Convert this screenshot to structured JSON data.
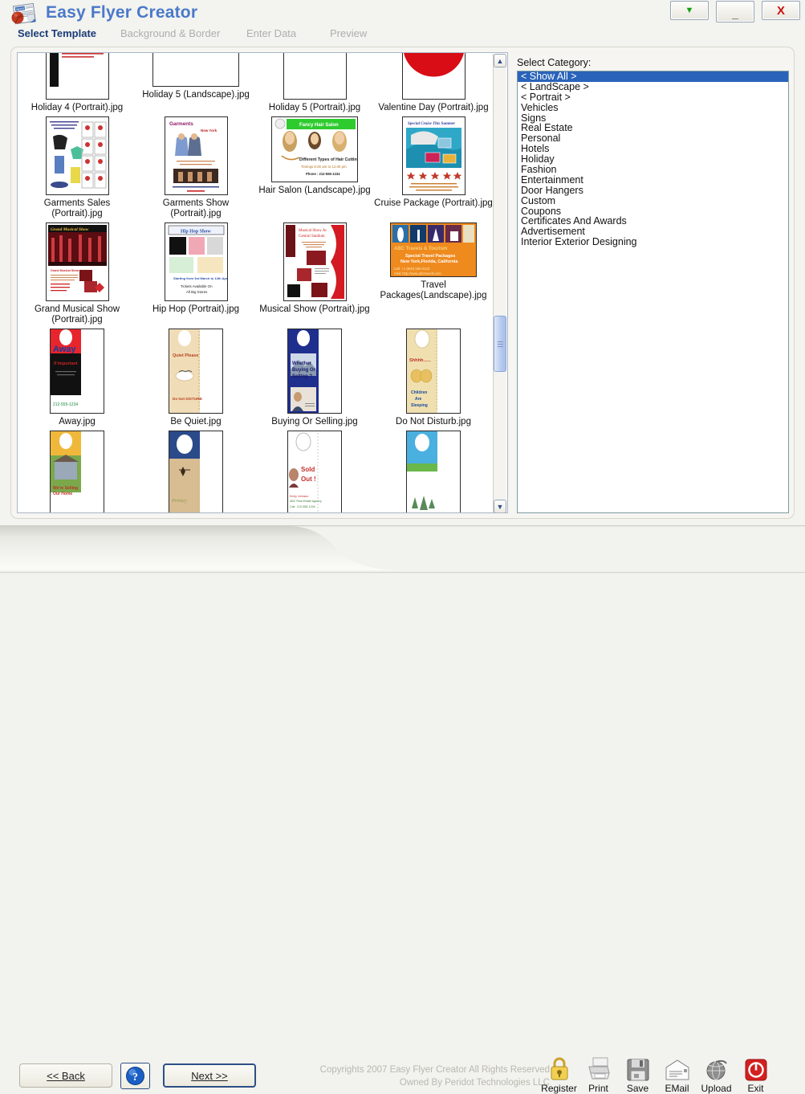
{
  "window": {
    "app_title": "Easy Flyer Creator",
    "logo_icon": "flyer-document-icon",
    "buttons": {
      "dropdown_label": "▼",
      "dropdown_icon": "chevron-down-icon",
      "minimize_label": "_",
      "minimize_icon": "minimize-icon",
      "close_label": "X",
      "close_icon": "close-icon"
    },
    "accent_blue": "#4a79c9",
    "close_red": "#cc1111",
    "dropdown_green": "#10a010"
  },
  "steps": [
    {
      "label": "Select Template",
      "active": true
    },
    {
      "label": "Background & Border",
      "active": false
    },
    {
      "label": "Enter Data",
      "active": false
    },
    {
      "label": "Preview",
      "active": false
    }
  ],
  "templates": {
    "rows": [
      [
        {
          "caption": "Holiday 4 (Portrait).jpg",
          "shape": "port"
        },
        {
          "caption": "Holiday 5 (Landscape).jpg",
          "shape": "land"
        },
        {
          "caption": "Holiday 5 (Portrait).jpg",
          "shape": "port"
        },
        {
          "caption": "Valentine Day (Portrait).jpg",
          "shape": "port"
        }
      ],
      [
        {
          "caption": "Garments Sales (Portrait).jpg",
          "shape": "port"
        },
        {
          "caption": "Garments Show (Portrait).jpg",
          "shape": "port"
        },
        {
          "caption": "Hair Salon (Landscape).jpg",
          "shape": "land"
        },
        {
          "caption": "Cruise Package (Portrait).jpg",
          "shape": "port"
        }
      ],
      [
        {
          "caption": "Grand Musical Show\n(Portrait).jpg",
          "shape": "port"
        },
        {
          "caption": "Hip Hop (Portrait).jpg",
          "shape": "port"
        },
        {
          "caption": "Musical Show (Portrait).jpg",
          "shape": "port"
        },
        {
          "caption": "Travel\nPackages(Landscape).jpg",
          "shape": "wide"
        }
      ],
      [
        {
          "caption": "Away.jpg",
          "shape": "hang"
        },
        {
          "caption": "Be Quiet.jpg",
          "shape": "hang"
        },
        {
          "caption": "Buying Or Selling.jpg",
          "shape": "hang"
        },
        {
          "caption": "Do Not Disturb.jpg",
          "shape": "hang"
        }
      ],
      [
        {
          "caption": "",
          "shape": "hang"
        },
        {
          "caption": "",
          "shape": "hang"
        },
        {
          "caption": "",
          "shape": "hang"
        },
        {
          "caption": "",
          "shape": "hang"
        }
      ]
    ],
    "scrollbar": {
      "up_icon": "scroll-up-icon",
      "down_icon": "scroll-down-icon",
      "up_label": "▲",
      "down_label": "▼"
    }
  },
  "category": {
    "label": "Select Category:",
    "selected": "< Show All >",
    "items": [
      "< Show All >",
      "< LandScape >",
      "< Portrait >",
      "Vehicles",
      "Signs",
      "Real Estate",
      "Personal",
      "Hotels",
      "Holiday",
      "Fashion",
      "Entertainment",
      "Door Hangers",
      "Custom",
      "Coupons",
      "Certificates And Awards",
      "Advertisement",
      "Interior Exterior Designing"
    ],
    "highlight_color": "#2a63ba"
  },
  "footer": {
    "back_label": "<< Back",
    "next_label": "Next >>",
    "help_label": "?",
    "help_icon": "help-question-icon",
    "copyright_line1": "Copyrights 2007 Easy Flyer Creator All Rights Reserved",
    "copyright_line2": "Owned By Peridot Technologies LLC",
    "tools": [
      {
        "label": "Register",
        "icon": "lock-icon"
      },
      {
        "label": "Print",
        "icon": "printer-icon"
      },
      {
        "label": "Save",
        "icon": "floppy-disk-icon"
      },
      {
        "label": "EMail",
        "icon": "envelope-icon"
      },
      {
        "label": "Upload",
        "icon": "globe-icon"
      },
      {
        "label": "Exit",
        "icon": "power-icon"
      }
    ]
  }
}
